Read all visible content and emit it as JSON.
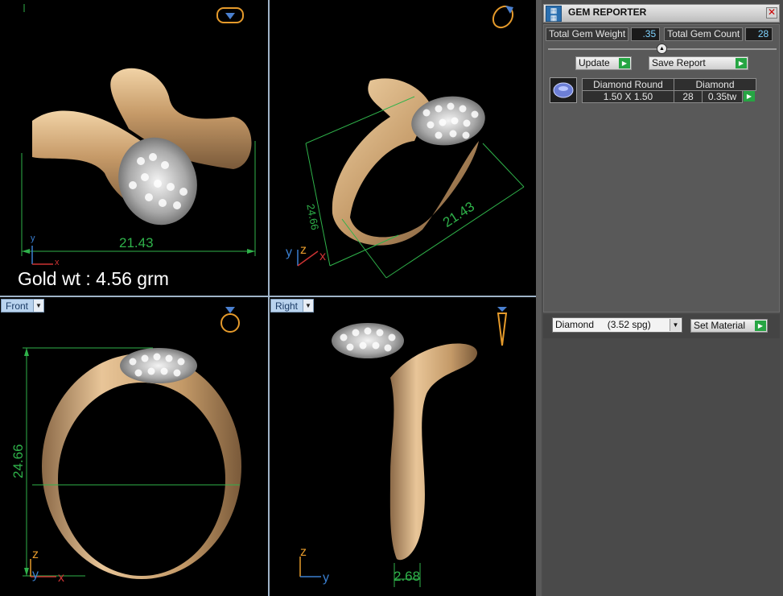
{
  "viewports": {
    "top": {
      "dim_width": "21.43",
      "note": "Gold wt : 4.56 grm",
      "axes": {
        "y": "y",
        "x": "x"
      }
    },
    "perspective": {
      "dim_width": "21.43",
      "dim_height": "24.66",
      "axes": {
        "z": "z",
        "y": "y",
        "x": "x"
      }
    },
    "front": {
      "label": "Front",
      "dim_height": "24.66",
      "axes": {
        "z": "z",
        "y": "y",
        "x": "x"
      }
    },
    "right": {
      "label": "Right",
      "dim_band": "2.68",
      "axes": {
        "z": "z",
        "y": "y"
      }
    }
  },
  "panel": {
    "title": "GEM REPORTER",
    "close_glyph": "✕",
    "total_weight_label": "Total Gem Weight",
    "total_weight_value": ".35",
    "total_count_label": "Total Gem Count",
    "total_count_value": "28",
    "update_label": "Update",
    "save_report_label": "Save Report",
    "table": {
      "header_shape": "Diamond Round",
      "header_material": "Diamond",
      "size": "1.50 X 1.50",
      "count": "28",
      "weight": "0.35tw"
    },
    "material_select": "Diamond     (3.52 spg)",
    "set_material_label": "Set Material"
  },
  "colors": {
    "dimension_green": "#2fb24a",
    "gold": "#c9a070",
    "panel_bg": "#4c4c4c",
    "value_blue": "#7fd3ff",
    "go_green": "#26a543"
  }
}
